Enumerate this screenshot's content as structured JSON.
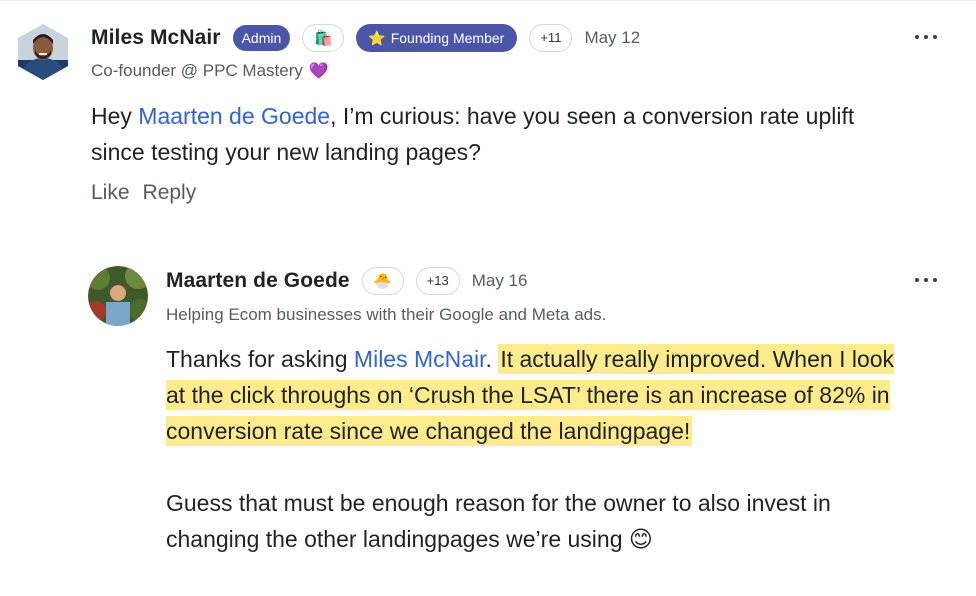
{
  "comments": [
    {
      "author": "Miles McNair",
      "badges": {
        "admin": "Admin",
        "emoji": "🛍️",
        "founding_icon": "⭐",
        "founding": "Founding Member",
        "count": "+11"
      },
      "date": "May 12",
      "subtitle": "Co-founder @ PPC Mastery",
      "subtitle_emoji": "💜",
      "body": {
        "prefix": "Hey ",
        "mention": "Maarten de Goede",
        "text": ", I’m curious: have you seen a conversion rate uplift since testing your new landing pages?"
      },
      "actions": {
        "like": "Like",
        "reply": "Reply"
      },
      "more_icon": "more-horizontal-icon"
    },
    {
      "author": "Maarten de Goede",
      "badges": {
        "emoji": "🐣",
        "count": "+13"
      },
      "date": "May 16",
      "subtitle": "Helping Ecom businesses with their Google and Meta ads.",
      "body": {
        "prefix": "Thanks for asking ",
        "mention": "Miles McNair",
        "after_mention": ". ",
        "highlighted": "It actually really improved. When I look at the click throughs on ‘Crush the LSAT’ there is an increase of 82% in conversion rate since we changed the landingpage!",
        "paragraph2": "Guess that must be enough reason for the owner to also invest in changing the other landingpages we’re using ",
        "paragraph2_emoji": "😊"
      },
      "more_icon": "more-horizontal-icon"
    }
  ],
  "colors": {
    "badge_bg": "#4b56a8",
    "mention": "#2f63d6",
    "highlight": "#fdeb8c",
    "muted_text": "#555b65"
  }
}
